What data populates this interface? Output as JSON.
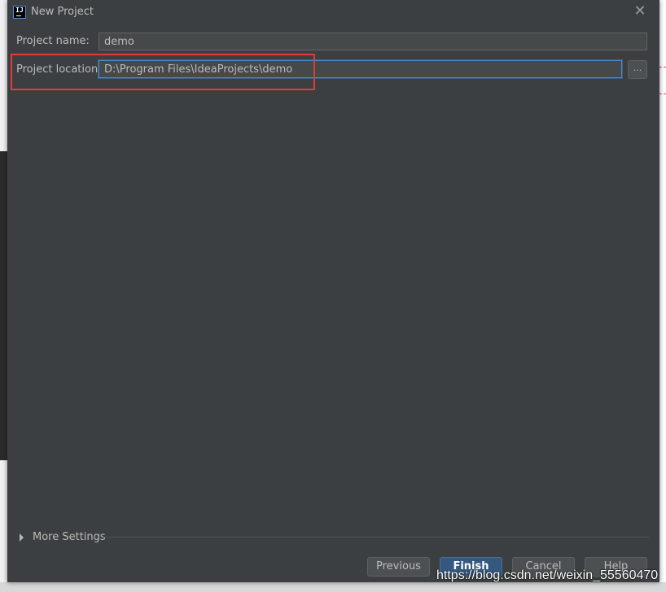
{
  "window": {
    "title": "New Project",
    "app_icon_text": "IJ",
    "close_glyph": "✕"
  },
  "form": {
    "project_name_label": "Project name:",
    "project_name_value": "demo",
    "project_location_label": "Project location:",
    "project_location_value": "D:\\Program Files\\IdeaProjects\\demo",
    "browse_label": "..."
  },
  "more_settings": {
    "label": "More Settings",
    "expanded": false
  },
  "buttons": {
    "previous": "Previous",
    "finish": "Finish",
    "cancel": "Cancel",
    "help": "Help"
  },
  "watermark": "https://blog.csdn.net/weixin_55560470",
  "colors": {
    "dialog_bg": "#3c3f41",
    "text": "#bbbbbb",
    "input_bg": "#45494a",
    "focus_border": "#4a88c7",
    "default_button": "#365880",
    "annotation_box": "#e03c3c"
  },
  "icons": {
    "app": "intellij-idea-icon",
    "close": "close-icon",
    "expand": "triangle-right-icon"
  }
}
